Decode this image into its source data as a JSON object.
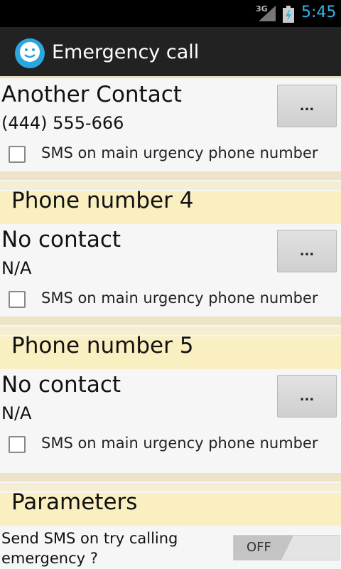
{
  "status_bar": {
    "network": "3G",
    "time": "5:45"
  },
  "action_bar": {
    "title": "Emergency call"
  },
  "contacts": [
    {
      "name": "Another Contact",
      "phone": "(444) 555-666",
      "button": "...",
      "sms_label": "SMS on main urgency phone number",
      "sms_checked": false
    },
    {
      "name": "No contact",
      "phone": "N/A",
      "button": "...",
      "sms_label": "SMS on main urgency phone number",
      "sms_checked": false
    },
    {
      "name": "No contact",
      "phone": "N/A",
      "button": "...",
      "sms_label": "SMS on main urgency phone number",
      "sms_checked": false
    }
  ],
  "sections": [
    {
      "title": "Phone number 4"
    },
    {
      "title": "Phone number 5"
    },
    {
      "title": "Parameters"
    }
  ],
  "parameters": {
    "send_sms_label": "Send SMS on try calling emergency ?",
    "send_sms_toggle": "OFF"
  },
  "colors": {
    "accent": "#33b5e5",
    "section_band": "#f9efc0",
    "action_bar": "#222222"
  }
}
